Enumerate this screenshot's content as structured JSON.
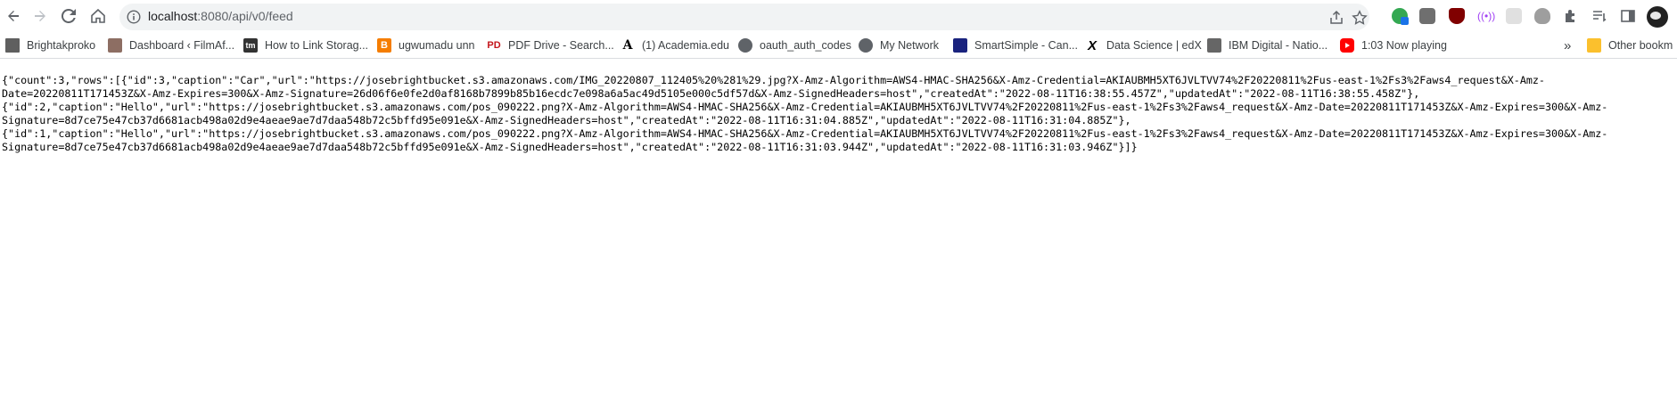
{
  "browser": {
    "url_host": "localhost",
    "url_path": ":8080/api/v0/feed"
  },
  "bookmarks": [
    {
      "label": "Brightakproko",
      "icon": "folder-icon"
    },
    {
      "label": "Dashboard ‹ FilmAf...",
      "icon": "filmaf-icon"
    },
    {
      "label": "How to Link Storag...",
      "icon": "tm-icon"
    },
    {
      "label": "ugwumadu unn",
      "icon": "blogger-icon"
    },
    {
      "label": "PDF Drive - Search...",
      "icon": "pdfdrive-icon"
    },
    {
      "label": "(1) Academia.edu",
      "icon": "academia-icon"
    },
    {
      "label": "oauth_auth_codes",
      "icon": "globe-icon"
    },
    {
      "label": "My Network",
      "icon": "globe-icon"
    },
    {
      "label": "SmartSimple - Can...",
      "icon": "smartsimple-icon"
    },
    {
      "label": "Data Science | edX",
      "icon": "edx-icon"
    },
    {
      "label": "IBM Digital - Natio...",
      "icon": "ibm-icon"
    },
    {
      "label": "1:03 Now playing",
      "icon": "youtube-icon"
    }
  ],
  "bookmarks_overflow": "»",
  "other_bookmarks": "Other bookm",
  "colors": {
    "omnibox_bg": "#f1f3f4",
    "youtube_red": "#ff0000",
    "blogger_orange": "#f57d00",
    "pdfdrive_red": "#c4161c"
  },
  "content": {
    "lines": [
      "{\"count\":3,\"rows\":[{\"id\":3,\"caption\":\"Car\",\"url\":\"https://josebrightbucket.s3.amazonaws.com/IMG_20220807_112405%20%281%29.jpg?X-Amz-Algorithm=AWS4-HMAC-SHA256&X-Amz-Credential=AKIAUBMH5XT6JVLTVV74%2F20220811%2Fus-east-1%2Fs3%2Faws4_request&X-Amz-",
      "Date=20220811T171453Z&X-Amz-Expires=300&X-Amz-Signature=26d06f6e0fe2d0af8168b7899b85b16ecdc7e098a6a5ac49d5105e000c5df57d&X-Amz-SignedHeaders=host\",\"createdAt\":\"2022-08-11T16:38:55.457Z\",\"updatedAt\":\"2022-08-11T16:38:55.458Z\"},",
      "{\"id\":2,\"caption\":\"Hello\",\"url\":\"https://josebrightbucket.s3.amazonaws.com/pos_090222.png?X-Amz-Algorithm=AWS4-HMAC-SHA256&X-Amz-Credential=AKIAUBMH5XT6JVLTVV74%2F20220811%2Fus-east-1%2Fs3%2Faws4_request&X-Amz-Date=20220811T171453Z&X-Amz-Expires=300&X-Amz-",
      "Signature=8d7ce75e47cb37d6681acb498a02d9e4aeae9ae7d7daa548b72c5bffd95e091e&X-Amz-SignedHeaders=host\",\"createdAt\":\"2022-08-11T16:31:04.885Z\",\"updatedAt\":\"2022-08-11T16:31:04.885Z\"},",
      "{\"id\":1,\"caption\":\"Hello\",\"url\":\"https://josebrightbucket.s3.amazonaws.com/pos_090222.png?X-Amz-Algorithm=AWS4-HMAC-SHA256&X-Amz-Credential=AKIAUBMH5XT6JVLTVV74%2F20220811%2Fus-east-1%2Fs3%2Faws4_request&X-Amz-Date=20220811T171453Z&X-Amz-Expires=300&X-Amz-",
      "Signature=8d7ce75e47cb37d6681acb498a02d9e4aeae9ae7d7daa548b72c5bffd95e091e&X-Amz-SignedHeaders=host\",\"createdAt\":\"2022-08-11T16:31:03.944Z\",\"updatedAt\":\"2022-08-11T16:31:03.946Z\"}]}"
    ]
  }
}
